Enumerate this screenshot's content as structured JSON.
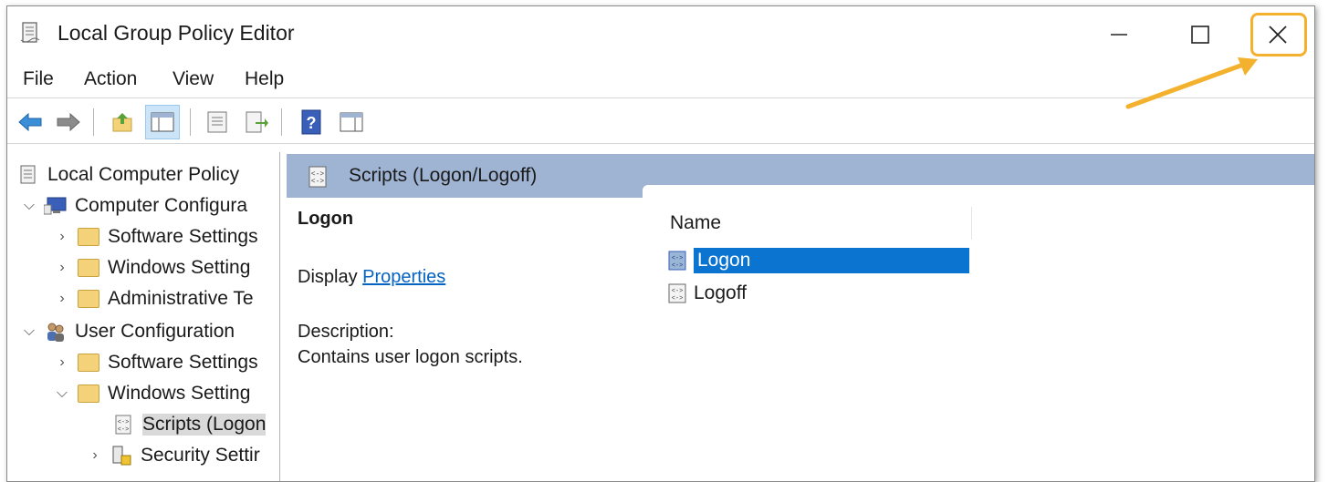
{
  "window": {
    "title": "Local Group Policy Editor",
    "icon": "policy-document-icon",
    "highlight_color": "#f4b12e"
  },
  "menu": {
    "file": "File",
    "action": "Action",
    "view": "View",
    "help": "Help"
  },
  "toolbar": {
    "icons": [
      "back-arrow-icon",
      "forward-arrow-icon",
      "up-folder-icon",
      "show-hide-tree-icon",
      "properties-icon",
      "export-list-icon",
      "help-icon",
      "show-action-pane-icon"
    ]
  },
  "tree": {
    "root": "Local Computer Policy",
    "computer": "Computer Configura",
    "computer_software": "Software Settings",
    "computer_windows": "Windows Setting",
    "computer_admin": "Administrative Te",
    "user": "User Configuration",
    "user_software": "Software Settings",
    "user_windows": "Windows Setting",
    "scripts": "Scripts (Logon",
    "security": "Security Settir"
  },
  "content": {
    "header": "Scripts (Logon/Logoff)",
    "heading": "Logon",
    "display_prefix": "Display",
    "display_link": "Properties",
    "description_label": "Description:",
    "description_text": "Contains user logon scripts.",
    "column_name": "Name",
    "items": [
      "Logon",
      "Logoff"
    ],
    "header_band_color": "#9fb4d3",
    "selection_color": "#0a74d0"
  }
}
